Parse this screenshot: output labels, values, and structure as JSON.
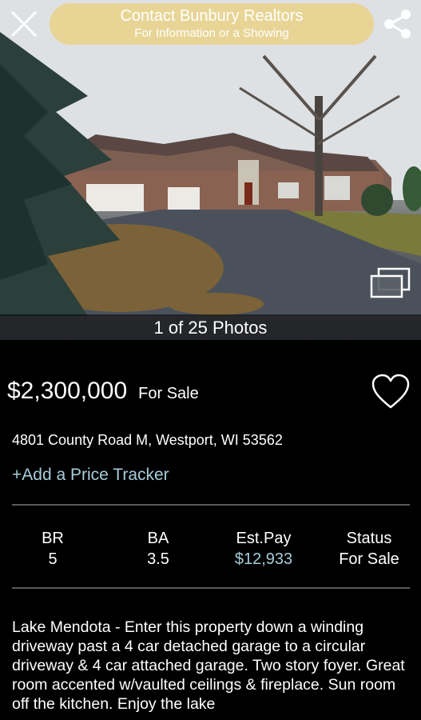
{
  "header": {
    "contact_title": "Contact Bunbury Realtors",
    "contact_subtitle": "For Information or a Showing",
    "accent_color": "#e8d596"
  },
  "photo": {
    "counter_text": "1 of 25 Photos"
  },
  "listing": {
    "price": "$2,300,000",
    "sale_status": "For Sale",
    "address": "4801 County Road M, Westport, WI 53562",
    "price_tracker_label": "+Add a Price Tracker",
    "link_color": "#a7cdda"
  },
  "stats": [
    {
      "label": "BR",
      "value": "5"
    },
    {
      "label": "BA",
      "value": "3.5"
    },
    {
      "label": "Est.Pay",
      "value": "$12,933"
    },
    {
      "label": "Status",
      "value": "For Sale"
    }
  ],
  "description": "Lake Mendota - Enter this property down a winding driveway past a 4 car detached garage to a circular driveway & 4 car attached garage. Two story foyer. Great room accented w/vaulted ceilings & fireplace. Sun room off the kitchen. Enjoy the lake"
}
